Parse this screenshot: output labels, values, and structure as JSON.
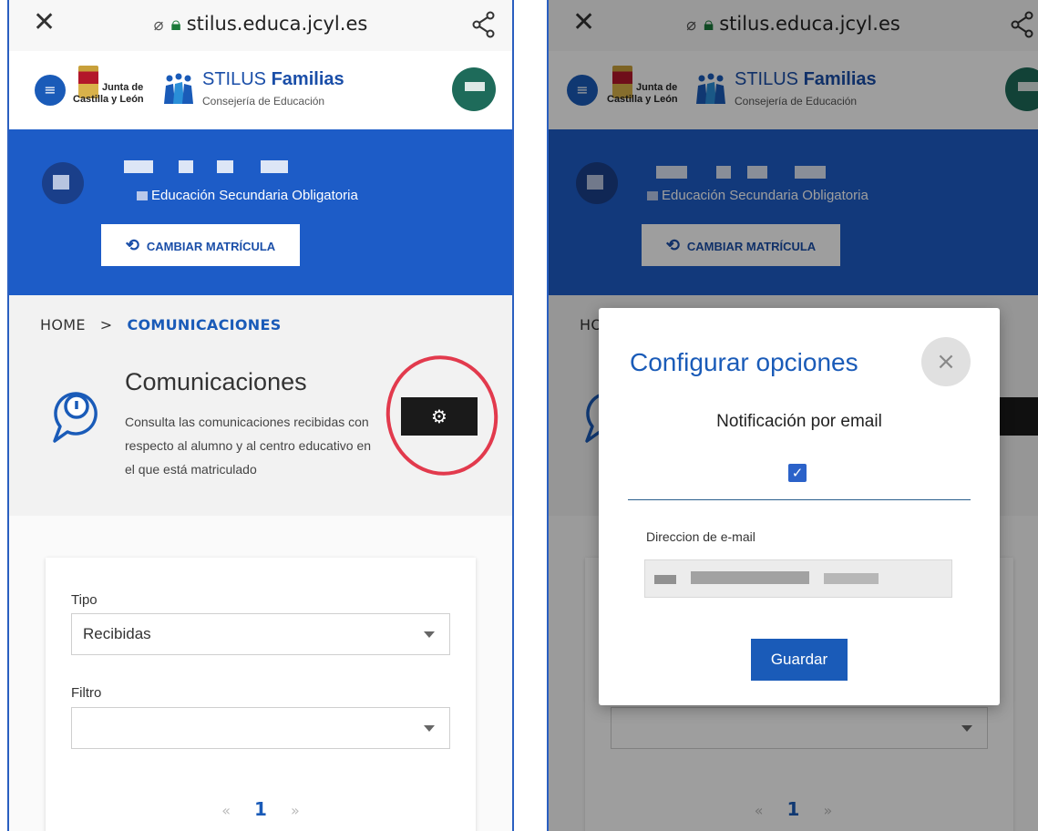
{
  "browser": {
    "close_glyph": "✕",
    "url": "stilus.educa.jcyl.es"
  },
  "header": {
    "menu_glyph": "≡",
    "jcyl_line1": "Junta de",
    "jcyl_line2": "Castilla y León",
    "app_name_prefix": "STILUS ",
    "app_name_bold": "Familias",
    "app_subtitle": "Consejería de Educación"
  },
  "student": {
    "course": "Educación Secundaria Obligatoria",
    "change_button": "CAMBIAR MATRÍCULA"
  },
  "breadcrumb": {
    "home": "HOME",
    "separator": ">",
    "current": "COMUNICACIONES"
  },
  "section": {
    "title": "Comunicaciones",
    "description": "Consulta las comunicaciones recibidas con respecto al alumno y al centro educativo en el que está matriculado",
    "settings_glyph": "⚙"
  },
  "filters": {
    "tipo_label": "Tipo",
    "tipo_value": "Recibidas",
    "filtro_label": "Filtro",
    "filtro_value": ""
  },
  "pagination": {
    "prev": "«",
    "current": "1",
    "next": "»"
  },
  "modal": {
    "title": "Configurar opciones",
    "close_glyph": "×",
    "notification_label": "Notificación por email",
    "notification_checked": true,
    "check_glyph": "✓",
    "email_label": "Direccion de e-mail",
    "email_value": ""
  },
  "colors": {
    "primary": "#1d5cc7",
    "accent_text": "#1a5bb8",
    "annotation": "#e23a4d"
  }
}
